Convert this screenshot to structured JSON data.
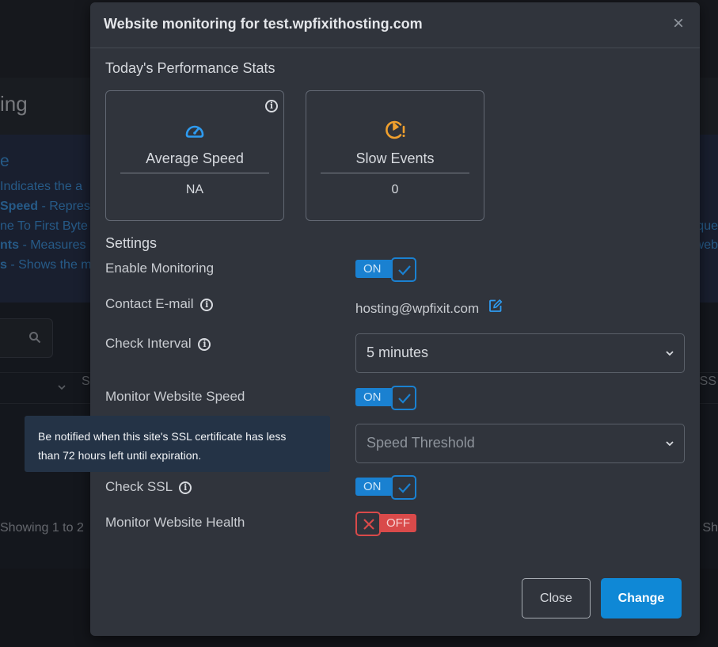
{
  "background": {
    "heading_fragment": "ing",
    "info_title_fragment": "e",
    "info_lines": [
      {
        "bold": "",
        "text": "Indicates the a"
      },
      {
        "bold": "Speed",
        "text": " - Repres"
      },
      {
        "bold": "",
        "text": "ne To First Byte"
      },
      {
        "bold": "nts",
        "text": " - Measures"
      },
      {
        "bold": "s",
        "text": " - Shows the m"
      }
    ],
    "info_right_fragments": [
      "que",
      "web"
    ],
    "table_header_fragment": "S",
    "table_header_right_fragment": "SS",
    "showing_text": "Showing 1 to 2",
    "showing_right_fragment": "Sh"
  },
  "modal": {
    "title": "Website monitoring for test.wpfixithosting.com",
    "close_symbol": "×",
    "stats_title": "Today's Performance Stats",
    "stats": [
      {
        "label": "Average Speed",
        "value": "NA",
        "icon": "speedometer-icon",
        "icon_color": "#2e9bf0"
      },
      {
        "label": "Slow Events",
        "value": "0",
        "icon": "slow-alert-icon",
        "icon_color": "#f0a02e"
      }
    ],
    "settings_title": "Settings",
    "settings": {
      "enable_monitoring": {
        "label": "Enable Monitoring",
        "state": "ON"
      },
      "contact_email": {
        "label": "Contact E-mail",
        "value": "hosting@wpfixit.com"
      },
      "check_interval": {
        "label": "Check Interval",
        "value": "5 minutes"
      },
      "monitor_speed": {
        "label": "Monitor Website Speed",
        "state": "ON"
      },
      "speed_threshold": {
        "placeholder": "Speed Threshold"
      },
      "check_ssl": {
        "label": "Check SSL",
        "state": "ON"
      },
      "monitor_health": {
        "label": "Monitor Website Health",
        "state": "OFF"
      }
    },
    "buttons": {
      "close": "Close",
      "change": "Change"
    }
  },
  "tooltip": {
    "lines": [
      "Be notified when this site's SSL certificate has less",
      "than 72 hours left until expiration."
    ]
  },
  "colors": {
    "accent_blue": "#1a81d1",
    "primary_button": "#0f88d6",
    "toggle_off_red": "#d94a4a",
    "modal_bg": "#30343c",
    "tooltip_bg": "#243346"
  }
}
